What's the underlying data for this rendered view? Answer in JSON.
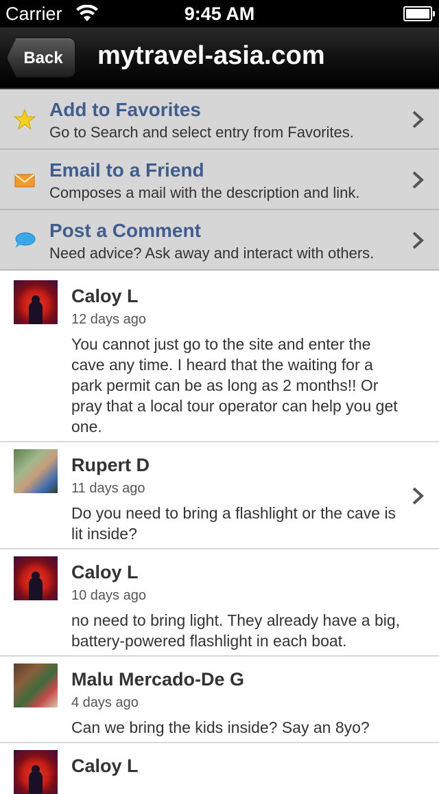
{
  "status_bar": {
    "carrier": "Carrier",
    "time": "9:45 AM"
  },
  "nav": {
    "back_label": "Back",
    "title": "mytravel-asia.com"
  },
  "actions": [
    {
      "title": "Add to Favorites",
      "subtitle": "Go to Search and select entry from Favorites.",
      "icon": "star-icon"
    },
    {
      "title": "Email to a Friend",
      "subtitle": "Composes a mail with the description and link.",
      "icon": "envelope-icon"
    },
    {
      "title": "Post a Comment",
      "subtitle": "Need advice? Ask away and interact with others.",
      "icon": "speech-bubble-icon"
    }
  ],
  "comments": [
    {
      "name": "Caloy L",
      "time": "12 days ago",
      "text": "You cannot just go to the site and enter the cave any time. I heard that the waiting for a park permit can be as long as 2 months!!  Or pray that a local tour operator can help you get one."
    },
    {
      "name": "Rupert D",
      "time": "11 days ago",
      "text": "Do you need to bring a flashlight or the cave is lit inside?"
    },
    {
      "name": "Caloy L",
      "time": "10 days ago",
      "text": "no need to bring light. They already have a big, battery-powered flashlight in each boat."
    },
    {
      "name": "Malu Mercado-De G",
      "time": "4 days ago",
      "text": "Can we bring the kids inside? Say an 8yo?"
    },
    {
      "name": "Caloy L",
      "time": "",
      "text": ""
    }
  ],
  "colors": {
    "accent": "#3f5e8f",
    "action_bg": "#d6d6d6",
    "nav_bg": "#000000"
  }
}
